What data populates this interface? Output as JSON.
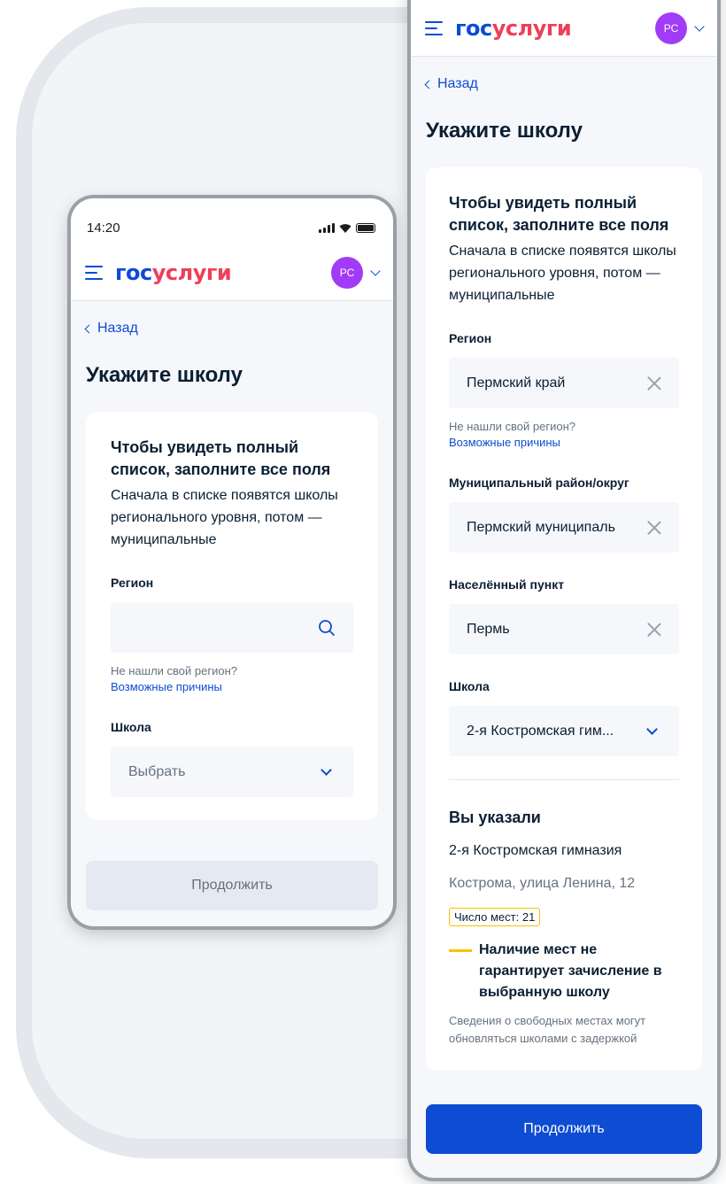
{
  "status": {
    "time": "14:20"
  },
  "header": {
    "logo_part1": "гос",
    "logo_part2": "услуги",
    "avatar_initials": "РС"
  },
  "nav": {
    "back_label": "Назад"
  },
  "page": {
    "title": "Укажите школу"
  },
  "card": {
    "heading": "Чтобы увидеть полный список, заполните все поля",
    "subtext": "Сначала в списке появятся школы регионального уровня, потом — муниципальные"
  },
  "left_form": {
    "region_label": "Регион",
    "region_value": "",
    "region_hint": "Не нашли свой регион?",
    "region_link": "Возможные причины",
    "school_label": "Школа",
    "school_placeholder": "Выбрать",
    "continue_label": "Продолжить"
  },
  "right_form": {
    "region_label": "Регион",
    "region_value": "Пермский край",
    "region_hint": "Не нашли свой регион?",
    "region_link": "Возможные причины",
    "district_label": "Муниципальный район/округ",
    "district_value": "Пермский муниципаль",
    "locality_label": "Населённый пункт",
    "locality_value": "Пермь",
    "school_label": "Школа",
    "school_value": "2-я Костромская гим...",
    "chosen_title": "Вы указали",
    "chosen_name": "2-я Костромская гимназия",
    "chosen_address": "Кострома, улица Ленина, 12",
    "seats_badge": "Число мест: 21",
    "warning": "Наличие мест не гарантирует зачисление в выбранную школу",
    "note": "Сведения о свободных местах могут обновляться школами с задержкой",
    "continue_label": "Продолжить"
  },
  "colors": {
    "primary": "#0d4cd3",
    "logo_red": "#ee3f58",
    "avatar": "#a13bf7",
    "warning": "#f5c400",
    "muted": "#66727f"
  }
}
